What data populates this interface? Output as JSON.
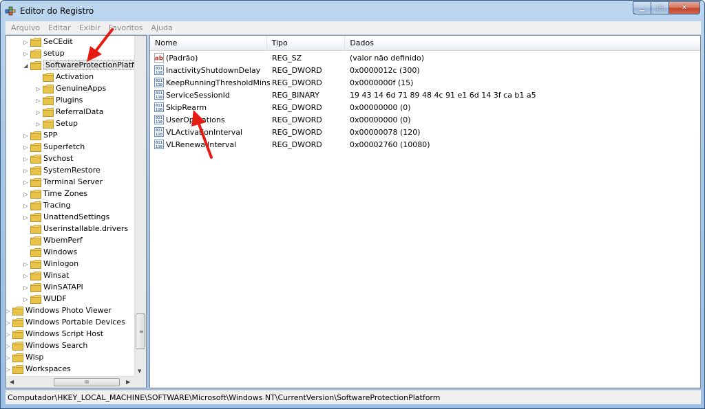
{
  "window": {
    "title": "Editor do Registro",
    "minimize": "▁",
    "maximize": "▢",
    "close": "✕"
  },
  "menu": [
    "Arquivo",
    "Editar",
    "Exibir",
    "Favoritos",
    "Ajuda"
  ],
  "tree": {
    "items": [
      {
        "label": "SeCEdit",
        "expander": "▷",
        "level": 2
      },
      {
        "label": "setup",
        "expander": "▷",
        "level": 2
      },
      {
        "label": "SoftwareProtectionPlatform",
        "expander": "◢",
        "level": 2,
        "selected": true
      },
      {
        "label": "Activation",
        "expander": "",
        "level": 3
      },
      {
        "label": "GenuineApps",
        "expander": "▷",
        "level": 3
      },
      {
        "label": "Plugins",
        "expander": "▷",
        "level": 3
      },
      {
        "label": "ReferralData",
        "expander": "▷",
        "level": 3
      },
      {
        "label": "Setup",
        "expander": "▷",
        "level": 3
      },
      {
        "label": "SPP",
        "expander": "▷",
        "level": 2
      },
      {
        "label": "Superfetch",
        "expander": "▷",
        "level": 2
      },
      {
        "label": "Svchost",
        "expander": "▷",
        "level": 2
      },
      {
        "label": "SystemRestore",
        "expander": "▷",
        "level": 2
      },
      {
        "label": "Terminal Server",
        "expander": "▷",
        "level": 2
      },
      {
        "label": "Time Zones",
        "expander": "▷",
        "level": 2
      },
      {
        "label": "Tracing",
        "expander": "▷",
        "level": 2
      },
      {
        "label": "UnattendSettings",
        "expander": "▷",
        "level": 2
      },
      {
        "label": "Userinstallable.drivers",
        "expander": "",
        "level": 2
      },
      {
        "label": "WbemPerf",
        "expander": "",
        "level": 2
      },
      {
        "label": "Windows",
        "expander": "",
        "level": 2
      },
      {
        "label": "Winlogon",
        "expander": "▷",
        "level": 2
      },
      {
        "label": "Winsat",
        "expander": "▷",
        "level": 2
      },
      {
        "label": "WinSATAPI",
        "expander": "▷",
        "level": 2
      },
      {
        "label": "WUDF",
        "expander": "▷",
        "level": 2
      },
      {
        "label": "Windows Photo Viewer",
        "expander": "▷",
        "level": 1
      },
      {
        "label": "Windows Portable Devices",
        "expander": "▷",
        "level": 1
      },
      {
        "label": "Windows Script Host",
        "expander": "▷",
        "level": 1
      },
      {
        "label": "Windows Search",
        "expander": "▷",
        "level": 1
      },
      {
        "label": "Wisp",
        "expander": "▷",
        "level": 1
      },
      {
        "label": "Workspaces",
        "expander": "▷",
        "level": 1
      }
    ],
    "hscroll_grip": "III",
    "vscroll_grip": "≡",
    "arrow_left": "◀",
    "arrow_right": "▶",
    "arrow_down": "▼"
  },
  "list": {
    "columns": {
      "name": "Nome",
      "type": "Tipo",
      "data": "Dados"
    },
    "rows": [
      {
        "icon": "string-value-icon",
        "name": "(Padrão)",
        "type": "REG_SZ",
        "data": "(valor não definido)"
      },
      {
        "icon": "binary-value-icon",
        "name": "InactivityShutdownDelay",
        "type": "REG_DWORD",
        "data": "0x0000012c (300)"
      },
      {
        "icon": "binary-value-icon",
        "name": "KeepRunningThresholdMins",
        "type": "REG_DWORD",
        "data": "0x0000000f (15)"
      },
      {
        "icon": "binary-value-icon",
        "name": "ServiceSessionId",
        "type": "REG_BINARY",
        "data": "19 43 14 6d 71 89 48 4c 91 e1 6d 14 3f ca b1 a5"
      },
      {
        "icon": "binary-value-icon",
        "name": "SkipRearm",
        "type": "REG_DWORD",
        "data": "0x00000000 (0)"
      },
      {
        "icon": "binary-value-icon",
        "name": "UserOperations",
        "type": "REG_DWORD",
        "data": "0x00000000 (0)"
      },
      {
        "icon": "binary-value-icon",
        "name": "VLActivationInterval",
        "type": "REG_DWORD",
        "data": "0x00000078 (120)"
      },
      {
        "icon": "binary-value-icon",
        "name": "VLRenewalInterval",
        "type": "REG_DWORD",
        "data": "0x00002760 (10080)"
      }
    ]
  },
  "statusbar": {
    "path": "Computador\\HKEY_LOCAL_MACHINE\\SOFTWARE\\Microsoft\\Windows NT\\CurrentVersion\\SoftwareProtectionPlatform"
  },
  "colors": {
    "annotation_arrow": "#e51c14",
    "folder": "#e8c34a",
    "binary_icon_blue": "#2a5db0",
    "string_icon_red": "#c0392b"
  }
}
